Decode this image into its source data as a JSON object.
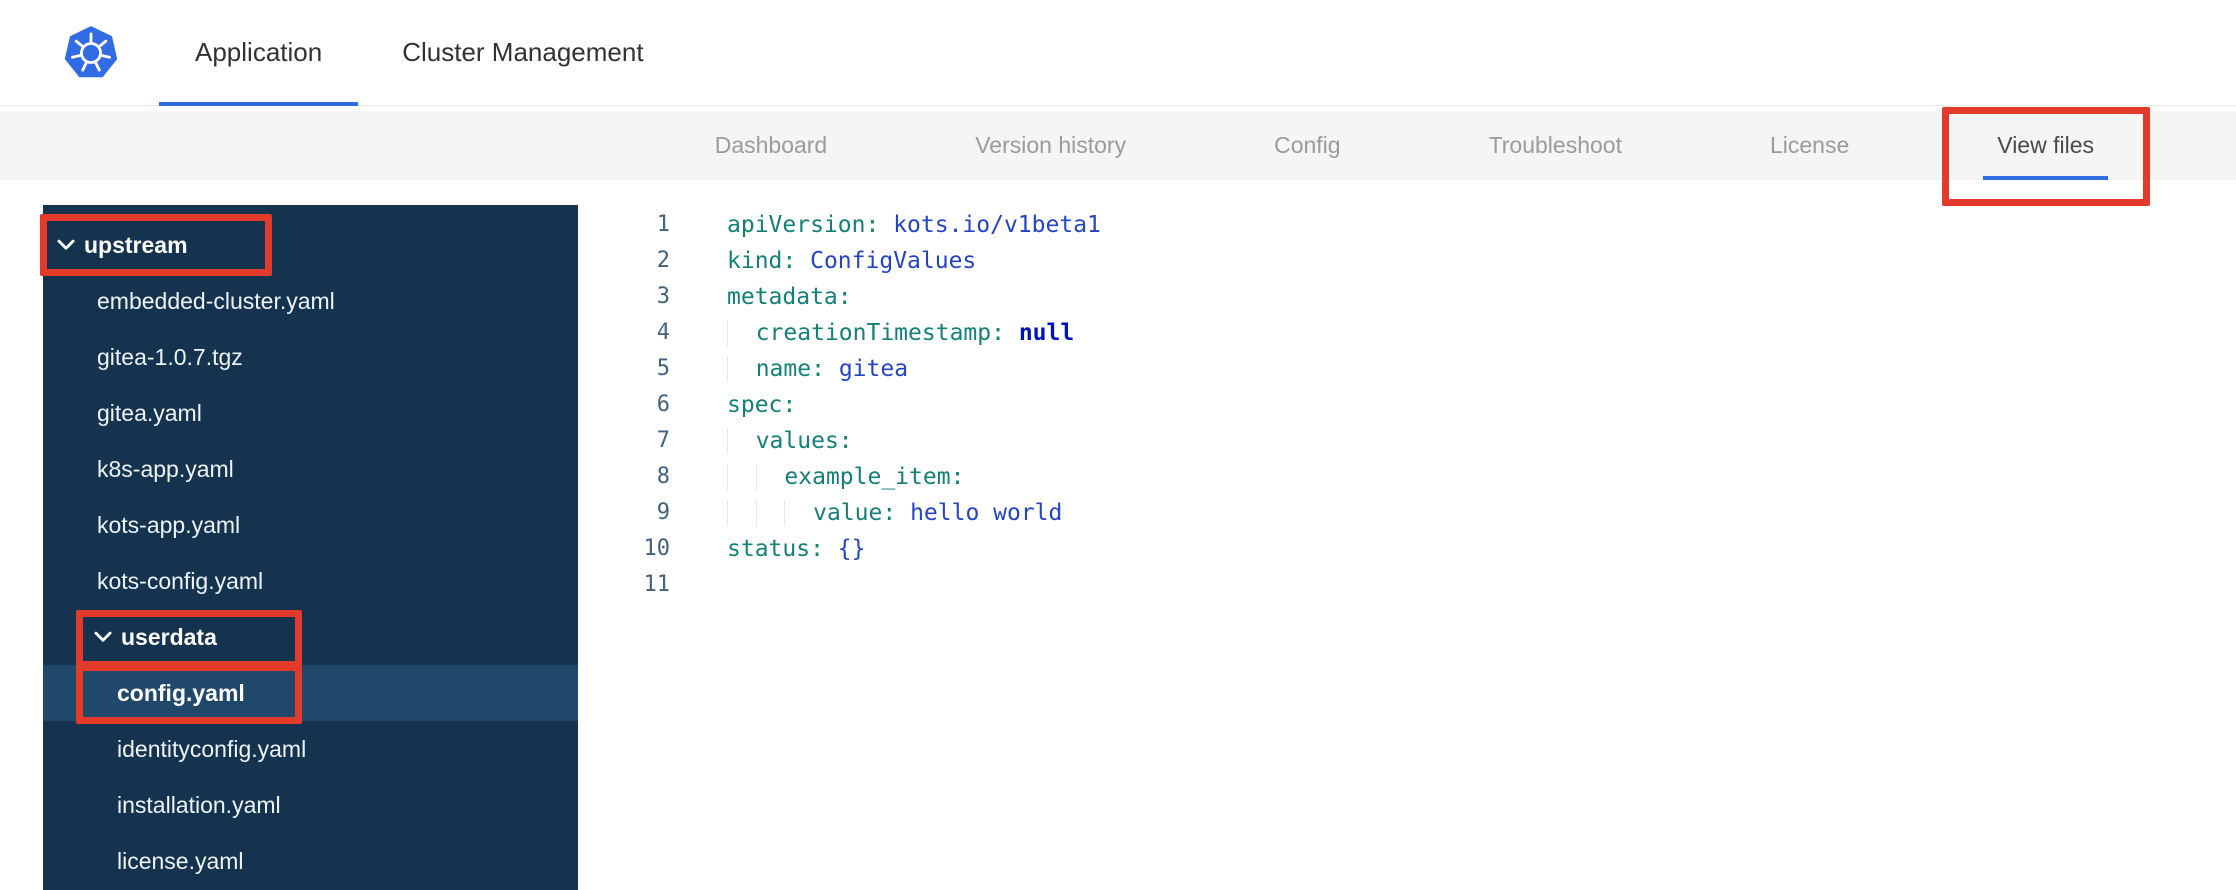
{
  "colors": {
    "accent_blue": "#326ce5",
    "annotation_red": "#e23a2b",
    "sidebar_bg": "#15334f",
    "sidebar_selected_bg": "#20486b",
    "subnav_bg": "#f5f5f5",
    "code_key": "#148078",
    "code_value": "#2444c4",
    "code_keyword": "#0011bf",
    "gutter_text": "#42627e"
  },
  "header": {
    "logo_icon": "kubernetes-logo",
    "tabs": [
      {
        "label": "Application",
        "active": true
      },
      {
        "label": "Cluster Management",
        "active": false
      }
    ]
  },
  "subnav": {
    "tabs": [
      {
        "label": "Dashboard",
        "active": false
      },
      {
        "label": "Version history",
        "active": false
      },
      {
        "label": "Config",
        "active": false
      },
      {
        "label": "Troubleshoot",
        "active": false
      },
      {
        "label": "License",
        "active": false
      },
      {
        "label": "View files",
        "active": true,
        "annotated": true
      }
    ]
  },
  "file_tree": {
    "items": [
      {
        "type": "folder",
        "label": "upstream",
        "depth": 0,
        "expanded": true,
        "annotated": true
      },
      {
        "type": "file",
        "label": "embedded-cluster.yaml",
        "depth": 1
      },
      {
        "type": "file",
        "label": "gitea-1.0.7.tgz",
        "depth": 1
      },
      {
        "type": "file",
        "label": "gitea.yaml",
        "depth": 1
      },
      {
        "type": "file",
        "label": "k8s-app.yaml",
        "depth": 1
      },
      {
        "type": "file",
        "label": "kots-app.yaml",
        "depth": 1
      },
      {
        "type": "file",
        "label": "kots-config.yaml",
        "depth": 1
      },
      {
        "type": "folder",
        "label": "userdata",
        "depth": 1,
        "expanded": true,
        "annotated": true
      },
      {
        "type": "file",
        "label": "config.yaml",
        "depth": 2,
        "selected": true,
        "annotated": true
      },
      {
        "type": "file",
        "label": "identityconfig.yaml",
        "depth": 2
      },
      {
        "type": "file",
        "label": "installation.yaml",
        "depth": 2
      },
      {
        "type": "file",
        "label": "license.yaml",
        "depth": 2
      }
    ]
  },
  "editor": {
    "lines": [
      {
        "num": "1",
        "indent": 0,
        "tokens": [
          {
            "t": "key",
            "s": "apiVersion:"
          },
          {
            "t": "plain",
            "s": " "
          },
          {
            "t": "value",
            "s": "kots.io/v1beta1"
          }
        ]
      },
      {
        "num": "2",
        "indent": 0,
        "tokens": [
          {
            "t": "key",
            "s": "kind:"
          },
          {
            "t": "plain",
            "s": " "
          },
          {
            "t": "value",
            "s": "ConfigValues"
          }
        ]
      },
      {
        "num": "3",
        "indent": 0,
        "tokens": [
          {
            "t": "key",
            "s": "metadata:"
          }
        ]
      },
      {
        "num": "4",
        "indent": 1,
        "tokens": [
          {
            "t": "key",
            "s": "creationTimestamp:"
          },
          {
            "t": "plain",
            "s": " "
          },
          {
            "t": "keyword",
            "s": "null"
          }
        ]
      },
      {
        "num": "5",
        "indent": 1,
        "tokens": [
          {
            "t": "key",
            "s": "name:"
          },
          {
            "t": "plain",
            "s": " "
          },
          {
            "t": "value",
            "s": "gitea"
          }
        ]
      },
      {
        "num": "6",
        "indent": 0,
        "tokens": [
          {
            "t": "key",
            "s": "spec:"
          }
        ]
      },
      {
        "num": "7",
        "indent": 1,
        "tokens": [
          {
            "t": "key",
            "s": "values:"
          }
        ]
      },
      {
        "num": "8",
        "indent": 2,
        "tokens": [
          {
            "t": "key",
            "s": "example_item:"
          }
        ]
      },
      {
        "num": "9",
        "indent": 3,
        "tokens": [
          {
            "t": "key",
            "s": "value:"
          },
          {
            "t": "plain",
            "s": " "
          },
          {
            "t": "value",
            "s": "hello world"
          }
        ]
      },
      {
        "num": "10",
        "indent": 0,
        "tokens": [
          {
            "t": "key",
            "s": "status:"
          },
          {
            "t": "plain",
            "s": " "
          },
          {
            "t": "value",
            "s": "{}"
          }
        ]
      },
      {
        "num": "11",
        "indent": 0,
        "tokens": []
      }
    ]
  },
  "annotations": {
    "boxes": [
      "view-files-tab",
      "upstream-folder",
      "userdata-folder",
      "config-yaml-file"
    ]
  }
}
